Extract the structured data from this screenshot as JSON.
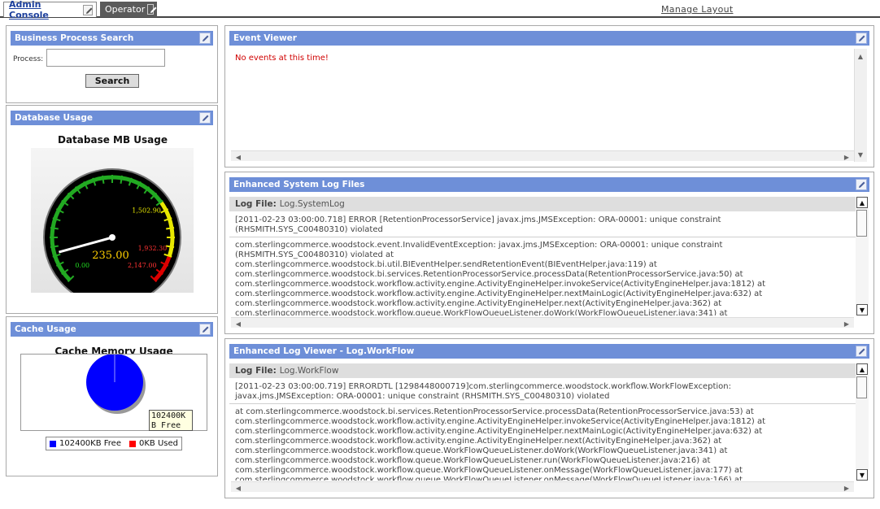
{
  "tabs": [
    {
      "label": "Admin Console"
    },
    {
      "label": "Operator"
    }
  ],
  "manage_layout": "Manage Layout",
  "bp_search": {
    "title": "Business Process Search",
    "process_label": "Process:",
    "process_value": "",
    "search_button": "Search"
  },
  "db_usage": {
    "title": "Database Usage",
    "chart_title": "Database MB Usage",
    "value_label": "235.00",
    "tick_labels": [
      "0.00",
      "1,502.90",
      "1,932.30",
      "2,147.00"
    ]
  },
  "cache_usage": {
    "title": "Cache Usage",
    "chart_title": "Cache Memory Usage",
    "tooltip_line1": "102400K",
    "tooltip_line2": "B Free",
    "legend": [
      "102400KB Free",
      "0KB Used"
    ],
    "colors": {
      "free": "#0000ff",
      "used": "#ff0000"
    }
  },
  "chart_data": [
    {
      "type": "gauge",
      "title": "Database MB Usage",
      "value": 235.0,
      "min": 0.0,
      "max": 2147.0,
      "ticks": [
        0.0,
        1502.9,
        1932.3,
        2147.0
      ],
      "bands": [
        {
          "from": 0.0,
          "to": 1502.9,
          "color": "#22aa22"
        },
        {
          "from": 1502.9,
          "to": 1932.3,
          "color": "#e8e800"
        },
        {
          "from": 1932.3,
          "to": 2147.0,
          "color": "#dd0000"
        }
      ]
    },
    {
      "type": "pie",
      "title": "Cache Memory Usage",
      "categories": [
        "102400KB Free",
        "0KB Used"
      ],
      "values": [
        102400,
        0
      ],
      "colors": [
        "#0000ff",
        "#ff0000"
      ]
    }
  ],
  "event_viewer": {
    "title": "Event Viewer",
    "message": "No events at this time!"
  },
  "system_log": {
    "title": "Enhanced System Log Files",
    "file_label": "Log File:",
    "file_name": "Log.SystemLog",
    "entries": [
      "[2011-02-23 03:00:00.718] ERROR [RetentionProcessorService] javax.jms.JMSException: ORA-00001: unique constraint\n(RHSMITH.SYS_C00480310) violated",
      "com.sterlingcommerce.woodstock.event.InvalidEventException: javax.jms.JMSException: ORA-00001: unique constraint\n(RHSMITH.SYS_C00480310) violated at\ncom.sterlingcommerce.woodstock.bi.util.BIEventHelper.sendRetentionEvent(BIEventHelper.java:119) at\ncom.sterlingcommerce.woodstock.bi.services.RetentionProcessorService.processData(RetentionProcessorService.java:50) at\ncom.sterlingcommerce.woodstock.workflow.activity.engine.ActivityEngineHelper.invokeService(ActivityEngineHelper.java:1812) at\ncom.sterlingcommerce.woodstock.workflow.activity.engine.ActivityEngineHelper.nextMainLogic(ActivityEngineHelper.java:632) at\ncom.sterlingcommerce.woodstock.workflow.activity.engine.ActivityEngineHelper.next(ActivityEngineHelper.java:362) at\ncom.sterlingcommerce.woodstock.workflow.queue.WorkFlowQueueListener.doWork(WorkFlowQueueListener.java:341) at"
    ]
  },
  "workflow_log": {
    "title": "Enhanced Log Viewer - Log.WorkFlow",
    "file_label": "Log File:",
    "file_name": "Log.WorkFlow",
    "entries": [
      "[2011-02-23 03:00:00.719] ERRORDTL [1298448000719]com.sterlingcommerce.woodstock.workflow.WorkFlowException:\njavax.jms.JMSException: ORA-00001: unique constraint (RHSMITH.SYS_C00480310) violated",
      "at com.sterlingcommerce.woodstock.bi.services.RetentionProcessorService.processData(RetentionProcessorService.java:53) at\ncom.sterlingcommerce.woodstock.workflow.activity.engine.ActivityEngineHelper.invokeService(ActivityEngineHelper.java:1812) at\ncom.sterlingcommerce.woodstock.workflow.activity.engine.ActivityEngineHelper.nextMainLogic(ActivityEngineHelper.java:632) at\ncom.sterlingcommerce.woodstock.workflow.activity.engine.ActivityEngineHelper.next(ActivityEngineHelper.java:362) at\ncom.sterlingcommerce.woodstock.workflow.queue.WorkFlowQueueListener.doWork(WorkFlowQueueListener.java:341) at\ncom.sterlingcommerce.woodstock.workflow.queue.WorkFlowQueueListener.run(WorkFlowQueueListener.java:216) at\ncom.sterlingcommerce.woodstock.workflow.queue.WorkFlowQueueListener.onMessage(WorkFlowQueueListener.java:177) at\ncom.sterlingcommerce.woodstock.workflow.queue.WorkFlowQueueListener.onMessage(WorkFlowQueueListener.java:166) at"
    ]
  }
}
